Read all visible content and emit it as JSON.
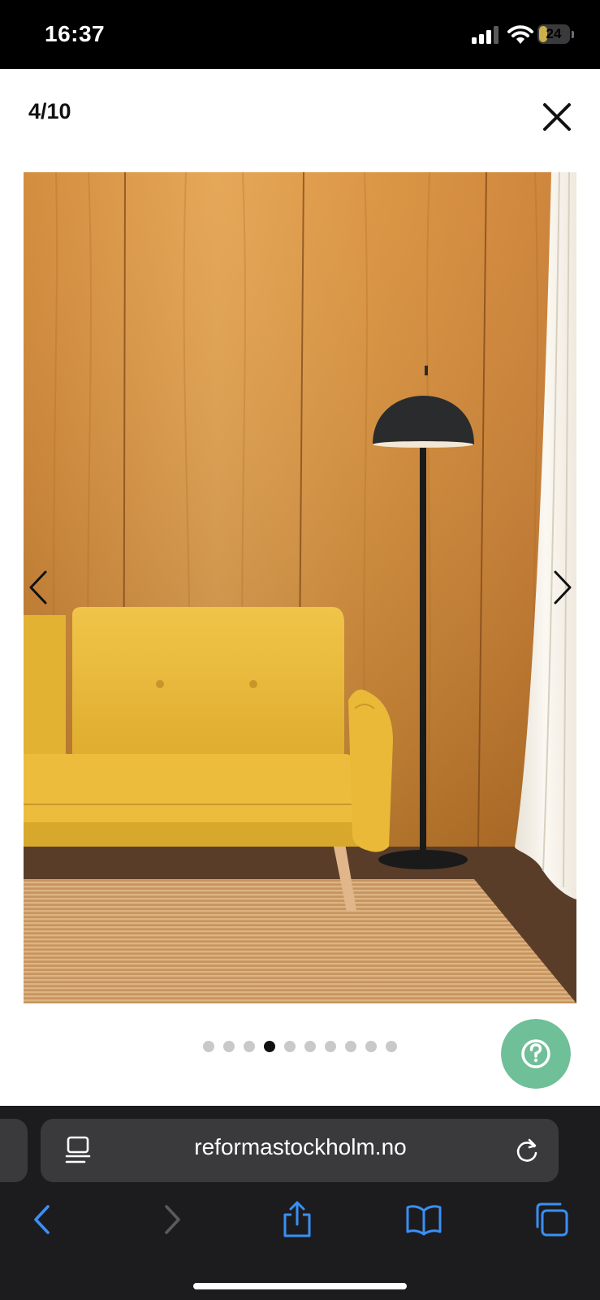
{
  "status_bar": {
    "time": "16:37",
    "battery_level": "24"
  },
  "gallery": {
    "counter": "4/10",
    "current_index": 4,
    "total": 10,
    "dots": [
      1,
      2,
      3,
      4,
      5,
      6,
      7,
      8,
      9,
      10
    ]
  },
  "browser": {
    "url": "reformastockholm.no"
  },
  "colors": {
    "accent_blue": "#3a8ff5",
    "help_button": "#6fbf98",
    "sofa": "#e6b83a",
    "wood": "#d08a35"
  },
  "icons": {
    "close": "close-icon",
    "prev": "chevron-left-icon",
    "next": "chevron-right-icon",
    "help": "question-mark-icon",
    "reader": "reader-icon",
    "reload": "reload-icon",
    "back": "back-arrow-icon",
    "forward": "forward-arrow-icon",
    "share": "share-icon",
    "bookmarks": "bookmarks-icon",
    "tabs": "tabs-icon"
  }
}
